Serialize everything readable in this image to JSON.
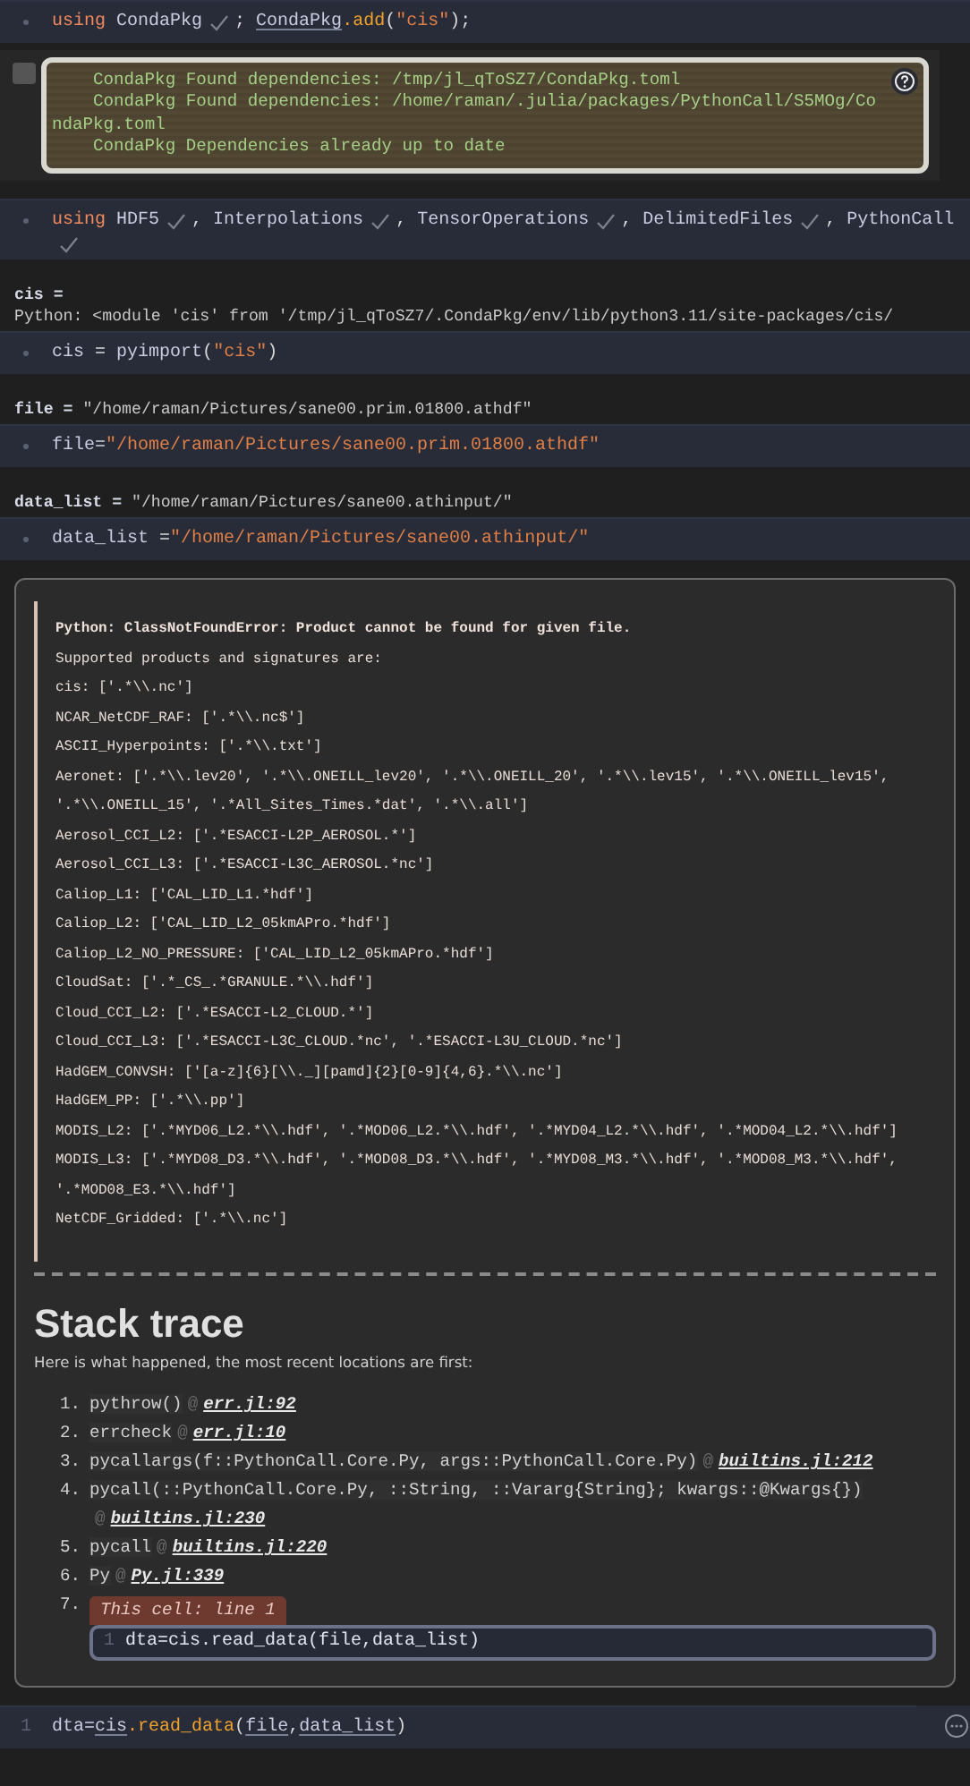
{
  "cells": [
    {
      "code": [
        [
          {
            "kind": "keyword",
            "text": "using "
          },
          {
            "kind": "name",
            "text": "CondaPkg"
          },
          {
            "kind": "check"
          },
          {
            "kind": "punct",
            "text": "; "
          },
          {
            "kind": "ref",
            "text": "CondaPkg"
          },
          {
            "kind": "func",
            "text": ".add"
          },
          {
            "kind": "punct",
            "text": "("
          },
          {
            "kind": "string",
            "text": "\"cis\""
          },
          {
            "kind": "punct",
            "text": ");"
          }
        ]
      ],
      "output": {
        "kind": "terminal",
        "lines": [
          "CondaPkg Found dependencies: /tmp/jl_qToSZ7/CondaPkg.toml",
          "CondaPkg Found dependencies: /home/raman/.julia/packages/PythonCall/S5MOg/CondaPkg.toml",
          "CondaPkg Dependencies already up to date"
        ]
      }
    },
    {
      "code": [
        [
          {
            "kind": "keyword",
            "text": "using "
          },
          {
            "kind": "name",
            "text": "HDF5"
          },
          {
            "kind": "check"
          },
          {
            "kind": "punct",
            "text": ", "
          },
          {
            "kind": "name",
            "text": "Interpolations"
          },
          {
            "kind": "check"
          },
          {
            "kind": "punct",
            "text": ", "
          },
          {
            "kind": "name",
            "text": "TensorOperations"
          },
          {
            "kind": "check"
          },
          {
            "kind": "punct",
            "text": ", "
          },
          {
            "kind": "name",
            "text": "DelimitedFiles"
          },
          {
            "kind": "check"
          },
          {
            "kind": "punct",
            "text": ", "
          },
          {
            "kind": "name",
            "text": "PythonCall"
          },
          {
            "kind": "check"
          }
        ]
      ]
    },
    {
      "output": {
        "kind": "value_block",
        "label": "cis =",
        "value": "Python: <module 'cis' from '/tmp/jl_qToSZ7/.CondaPkg/env/lib/python3.11/site-packages/cis/"
      },
      "code": [
        [
          {
            "kind": "name",
            "text": "cis"
          },
          {
            "kind": "punct",
            "text": " = "
          },
          {
            "kind": "name",
            "text": "pyimport"
          },
          {
            "kind": "punct",
            "text": "("
          },
          {
            "kind": "string",
            "text": "\"cis\""
          },
          {
            "kind": "punct",
            "text": ")"
          }
        ]
      ]
    },
    {
      "output": {
        "kind": "value_inline",
        "label": "file =",
        "value": "\"/home/raman/Pictures/sane00.prim.01800.athdf\""
      },
      "code": [
        [
          {
            "kind": "name",
            "text": "file="
          },
          {
            "kind": "string",
            "text": "\"/home/raman/Pictures/sane00.prim.01800.athdf\""
          }
        ]
      ]
    },
    {
      "output": {
        "kind": "value_inline",
        "label": "data_list =",
        "value": "\"/home/raman/Pictures/sane00.athinput/\""
      },
      "code": [
        [
          {
            "kind": "name",
            "text": "data_list"
          },
          {
            "kind": "punct",
            "text": " ="
          },
          {
            "kind": "string",
            "text": "\"/home/raman/Pictures/sane00.athinput/\""
          }
        ]
      ]
    },
    {
      "output": {
        "kind": "error",
        "title": "Python: ClassNotFoundError: Product cannot be found for given file.",
        "lines": [
          "Supported products and signatures are:",
          "cis: ['.*\\\\.nc']",
          "NCAR_NetCDF_RAF: ['.*\\\\.nc$']",
          "ASCII_Hyperpoints: ['.*\\\\.txt']",
          "Aeronet: ['.*\\\\.lev20', '.*\\\\.ONEILL_lev20', '.*\\\\.ONEILL_20', '.*\\\\.lev15', '.*\\\\.ONEILL_lev15', '.*\\\\.ONEILL_15', '.*All_Sites_Times.*dat', '.*\\\\.all']",
          "Aerosol_CCI_L2: ['.*ESACCI-L2P_AEROSOL.*']",
          "Aerosol_CCI_L3: ['.*ESACCI-L3C_AEROSOL.*nc']",
          "Caliop_L1: ['CAL_LID_L1.*hdf']",
          "Caliop_L2: ['CAL_LID_L2_05kmAPro.*hdf']",
          "Caliop_L2_NO_PRESSURE: ['CAL_LID_L2_05kmAPro.*hdf']",
          "CloudSat: ['.*_CS_.*GRANULE.*\\\\.hdf']",
          "Cloud_CCI_L2: ['.*ESACCI-L2_CLOUD.*']",
          "Cloud_CCI_L3: ['.*ESACCI-L3C_CLOUD.*nc', '.*ESACCI-L3U_CLOUD.*nc']",
          "HadGEM_CONVSH: ['[a-z]{6}[\\\\._][pamd]{2}[0-9]{4,6}.*\\\\.nc']",
          "HadGEM_PP: ['.*\\\\.pp']",
          "MODIS_L2: ['.*MYD06_L2.*\\\\.hdf', '.*MOD06_L2.*\\\\.hdf', '.*MYD04_L2.*\\\\.hdf', '.*MOD04_L2.*\\\\.hdf']",
          "MODIS_L3: ['.*MYD08_D3.*\\\\.hdf', '.*MOD08_D3.*\\\\.hdf', '.*MYD08_M3.*\\\\.hdf', '.*MOD08_M3.*\\\\.hdf', '.*MOD08_E3.*\\\\.hdf']",
          "NetCDF_Gridded: ['.*\\\\.nc']"
        ],
        "stack_heading": "Stack trace",
        "stack_intro": "Here is what happened, the most recent locations are first:",
        "frames": [
          {
            "kind": "frame",
            "number": "1.",
            "call": "pythrow()",
            "at": "@",
            "file": "err.jl:92"
          },
          {
            "kind": "frame",
            "number": "2.",
            "call": "errcheck",
            "at": "@",
            "file": "err.jl:10"
          },
          {
            "kind": "frame",
            "number": "3.",
            "call": "pycallargs(f::PythonCall.Core.Py, args::PythonCall.Core.Py)",
            "at": "@",
            "file": "builtins.jl:212"
          },
          {
            "kind": "frame",
            "number": "4.",
            "call": "pycall(::PythonCall.Core.Py, ::String, ::Vararg{String}; kwargs::@Kwargs{})",
            "at": "@",
            "file": "builtins.jl:230"
          },
          {
            "kind": "frame",
            "number": "5.",
            "call": "pycall",
            "at": "@",
            "file": "builtins.jl:220"
          },
          {
            "kind": "frame",
            "number": "6.",
            "call": "Py",
            "at": "@",
            "file": "Py.jl:339"
          },
          {
            "kind": "cell",
            "number": "7.",
            "badge": "This cell: line 1",
            "line_number": "1",
            "code": "dta=cis.read_data(file,data_list)"
          }
        ]
      }
    },
    {
      "line_number": "1",
      "code": [
        [
          {
            "kind": "name",
            "text": "dta="
          },
          {
            "kind": "ref",
            "text": "cis"
          },
          {
            "kind": "func",
            "text": ".read_data"
          },
          {
            "kind": "punct",
            "text": "("
          },
          {
            "kind": "ref",
            "text": "file"
          },
          {
            "kind": "punct",
            "text": ","
          },
          {
            "kind": "ref",
            "text": "data_list"
          },
          {
            "kind": "punct",
            "text": ")"
          }
        ]
      ]
    }
  ]
}
